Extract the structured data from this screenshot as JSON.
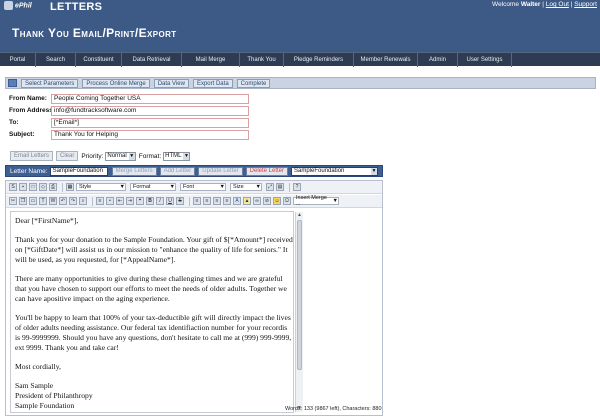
{
  "header": {
    "logo_text": "ePhil",
    "app_name": "LETTERS",
    "welcome_prefix": "Welcome ",
    "welcome_user": "Walter",
    "sep": " | ",
    "logout": "Log Out",
    "support": "Support",
    "page_title": "Thank You Email/Print/Export"
  },
  "nav": {
    "items": [
      "Portal",
      "Search",
      "Constituent",
      "Data Retrieval",
      "Mail Merge",
      "Thank You",
      "Pledge Reminders",
      "Member Renewals",
      "Admin",
      "User Settings"
    ]
  },
  "steps": {
    "items": [
      "Select Parameters",
      "Process Online Merge",
      "Data View",
      "Export Data",
      "Complete"
    ]
  },
  "form": {
    "from_name_label": "From Name:",
    "from_name_value": "People Coming Together USA",
    "from_address_label": "From Address:",
    "from_address_value": "info@fundtracksoftware.com",
    "to_label": "To:",
    "to_value": "[*Email*]",
    "subject_label": "Subject:",
    "subject_value": "Thank You for Helping"
  },
  "controls": {
    "email_letters": "Email Letters",
    "clear": "Clear",
    "priority_label": "Priority:",
    "priority_value": "Normal",
    "format_label": "Format:",
    "format_value": "HTML"
  },
  "letter_bar": {
    "label": "Letter Name:",
    "name_value": "SampleFoundation",
    "merge_letters": "Merge Letters",
    "add_letter": "Add Letter",
    "update_letter": "Update Letter",
    "delete_letter": "Delete Letter",
    "select_value": "SampleFoundation"
  },
  "toolbar": {
    "style": "Style",
    "format": "Format",
    "font": "Font",
    "size": "Size",
    "insert_merge": "Insert Merge ..."
  },
  "letter": {
    "greeting": "Dear [*FirstName*],",
    "p1": "Thank you for your donation to the Sample Foundation. Your gift of $[*Amount*] received on [*GiftDate*] will assist us in our mission to \"enhance the quality of life for seniors.\" It will be used, as you requested, for [*AppealName*].",
    "p2": "There are many opportunities to give during these challenging times and we are grateful that you have chosen to support our efforts to meet the needs of older adults. Together we can have apositive impact on the aging experience.",
    "p3": "You'll be happy to learn that 100% of your tax-deductible gift will directly impact the lives of older adults needing assistance. Our federal tax identifiaction number for your recordis is 99-9999999. Should you have any questions, don't hesitate to call me at (999) 999-9999, ext 9999. Thank you and take car!",
    "closing": "Most cordially,",
    "sig_name": "Sam Sample",
    "sig_title": "President of Philanthropy",
    "sig_org": "Sample Foundation"
  },
  "status": {
    "word_count": "Words: 133 (9867 left), Characters: 880"
  }
}
